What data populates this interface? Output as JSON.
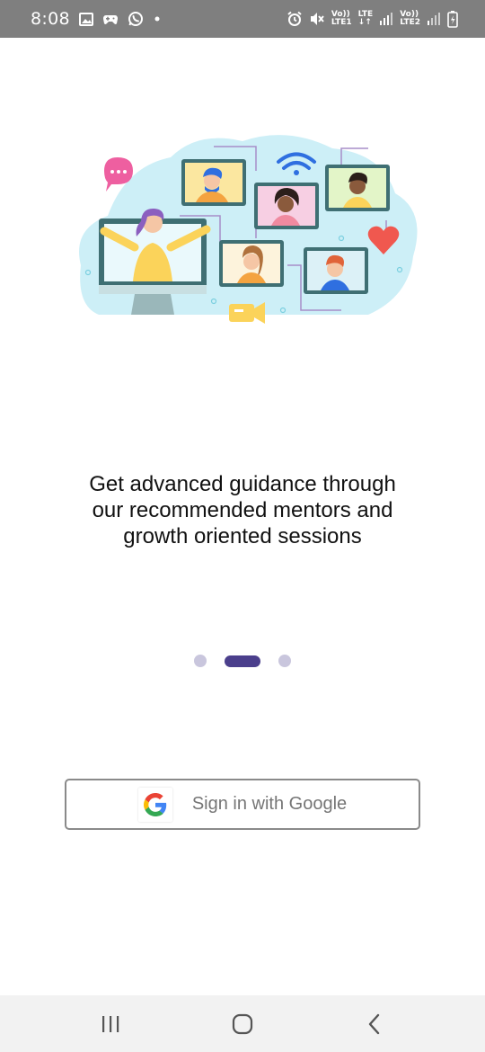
{
  "status_bar": {
    "time": "8:08",
    "left_icons": [
      "gallery-icon",
      "game-controller-icon",
      "whatsapp-icon",
      "notification-dot-icon"
    ],
    "right_icons": [
      "alarm-icon",
      "mute-icon",
      "sim1-signal-icon",
      "sim2-signal-icon",
      "battery-charging-icon"
    ],
    "sim1": {
      "top": "Vo))",
      "mid": "LTE",
      "bottom": "LTE1"
    },
    "sim2": {
      "top": "Vo))",
      "bottom": "LTE2"
    }
  },
  "onboarding": {
    "illustration": "video-conference-illustration",
    "tagline_lines": [
      "Get advanced guidance through",
      "our recommended mentors and",
      "growth oriented sessions"
    ],
    "page_count": 3,
    "active_page": 2
  },
  "auth": {
    "google_button_label": "Sign in with Google",
    "google_icon": "google-g-icon"
  },
  "nav_bar": {
    "buttons": [
      "recent-apps-icon",
      "home-icon",
      "back-icon"
    ]
  },
  "colors": {
    "status_bar_bg": "#7f7f7f",
    "pager_active": "#4b3f8c",
    "pager_inactive": "#c9c6dd",
    "button_border": "#8a8a8a",
    "button_text": "#757575",
    "nav_bar_bg": "#f2f2f2",
    "illustration_blob": "#cdeff7",
    "illustration_frame": "#3f6f73",
    "illustration_yellow": "#fbd35a",
    "illustration_heart": "#f0584f"
  }
}
